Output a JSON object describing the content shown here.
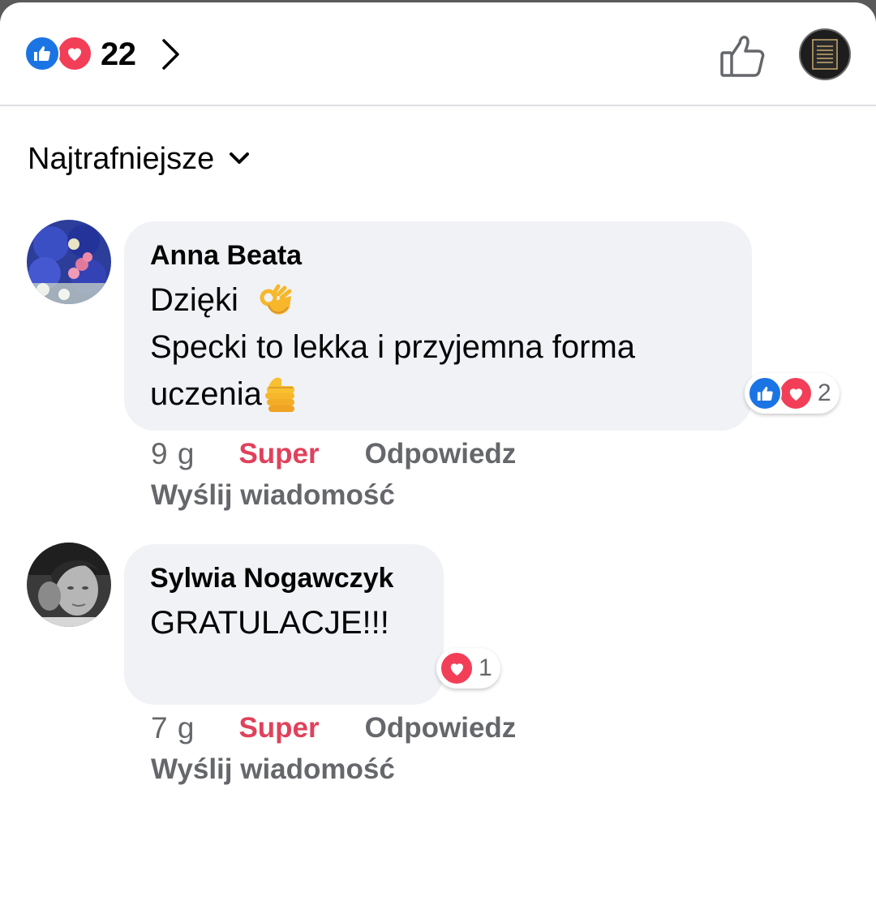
{
  "header": {
    "reaction_count": "22",
    "reaction_icons": [
      "like-icon",
      "love-icon"
    ]
  },
  "sort": {
    "label": "Najtrafniejsze"
  },
  "comments": [
    {
      "author": "Anna Beata",
      "line1": "Dzięki",
      "line2": "Specki to lekka i przyjemna forma",
      "line3": "uczenia",
      "emoji": [
        "ok-hand-emoji",
        "thumbs-up-emoji"
      ],
      "reactions": {
        "icons": [
          "like-icon",
          "love-icon"
        ],
        "count": "2"
      },
      "time": "9 g",
      "super_label": "Super",
      "reply_label": "Odpowiedz",
      "message_label": "Wyślij wiadomość"
    },
    {
      "author": "Sylwia Nogawczyk",
      "line1": "GRATULACJE!!!",
      "reactions": {
        "icons": [
          "love-icon"
        ],
        "count": "1"
      },
      "time": "7 g",
      "super_label": "Super",
      "reply_label": "Odpowiedz",
      "message_label": "Wyślij wiadomość"
    }
  ],
  "colors": {
    "like_blue": "#1b74e4",
    "love_red": "#f33e58",
    "super_red": "#e0415b",
    "bubble_bg": "#f0f2f5",
    "meta_gray": "#65676b"
  }
}
